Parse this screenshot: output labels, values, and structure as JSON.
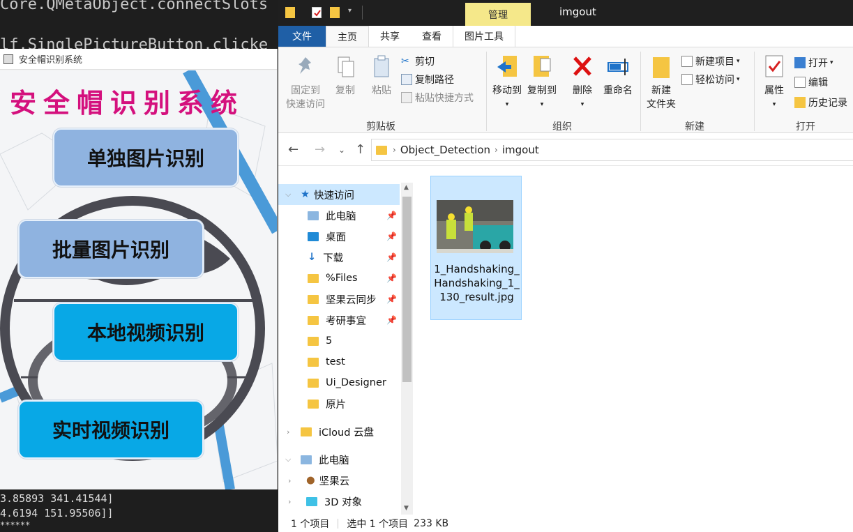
{
  "code_editor": {
    "line_top": "Core.QMetaObject.connectSlots",
    "line_mid": "lf.SinglePictureButton.clicke",
    "console": [
      "3.85893 341.41544]",
      "4.6194  151.95506]]",
      "******"
    ]
  },
  "qt_app": {
    "window_title": "安全帽识别系统",
    "heading": "安全帽识别系统",
    "buttons": [
      {
        "label": "单独图片识别",
        "color": "#8fb3e0"
      },
      {
        "label": "批量图片识别",
        "color": "#8fb3e0"
      },
      {
        "label": "本地视频识别",
        "color": "#08a8e6"
      },
      {
        "label": "实时视频识别",
        "color": "#08a8e6"
      }
    ]
  },
  "explorer": {
    "context_tab": "管理",
    "title": "imgout",
    "ribbon_tabs": [
      "文件",
      "主页",
      "共享",
      "查看",
      "图片工具"
    ],
    "groups": {
      "clipboard": {
        "label": "剪贴板",
        "pin_quick": "固定到\n快速访问",
        "copy": "复制",
        "paste": "粘贴",
        "cut": "剪切",
        "copy_path": "复制路径",
        "paste_shortcut": "粘贴快捷方式"
      },
      "organize": {
        "label": "组织",
        "move_to": "移动到",
        "copy_to": "复制到",
        "delete": "删除",
        "rename": "重命名"
      },
      "new": {
        "label": "新建",
        "new_folder": "新建\n文件夹",
        "new_item": "新建项目",
        "easy_access": "轻松访问"
      },
      "open": {
        "label": "打开",
        "properties": "属性",
        "open": "打开",
        "edit": "编辑",
        "history": "历史记录"
      }
    },
    "breadcrumb": [
      "Object_Detection",
      "imgout"
    ],
    "nav": {
      "quick_access": "快速访问",
      "items": [
        {
          "label": "此电脑",
          "pinned": true,
          "icon": "pc-icon"
        },
        {
          "label": "桌面",
          "pinned": true,
          "icon": "desktop-icon"
        },
        {
          "label": "下载",
          "pinned": true,
          "icon": "download-icon"
        },
        {
          "label": "%Files",
          "pinned": true,
          "icon": "folder-icon"
        },
        {
          "label": "坚果云同步",
          "pinned": true,
          "icon": "folder-icon"
        },
        {
          "label": "考研事宜",
          "pinned": true,
          "icon": "folder-icon"
        },
        {
          "label": "5",
          "pinned": false,
          "icon": "folder-icon"
        },
        {
          "label": "test",
          "pinned": false,
          "icon": "folder-icon"
        },
        {
          "label": "Ui_Designer",
          "pinned": false,
          "icon": "folder-icon"
        },
        {
          "label": "原片",
          "pinned": false,
          "icon": "folder-icon"
        }
      ],
      "icloud": "iCloud 云盘",
      "this_pc": "此电脑",
      "pc_children": [
        "坚果云",
        "3D 对象"
      ]
    },
    "file": {
      "name": "1_Handshaking_Handshaking_1_130_result.jpg"
    },
    "status": {
      "count": "1 个项目",
      "selected": "选中 1 个项目",
      "size": "233 KB"
    }
  }
}
